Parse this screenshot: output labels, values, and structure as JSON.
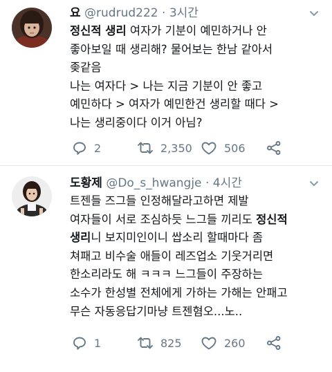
{
  "tweets": [
    {
      "name": "요",
      "handle": "@rudrud222",
      "separator": "·",
      "time": "3시간",
      "lines": [
        [
          {
            "text": "정신적 생리",
            "bold": true
          },
          {
            "text": " 여자가 기분이 예민하거나 안"
          }
        ],
        [
          {
            "text": "좋아보일 때 생리해? 물어보는 한남 같아서"
          }
        ],
        [
          {
            "text": "좆같음"
          }
        ],
        [
          {
            "text": "나는 여자다 > 나는 지금 기분이 안 좋고"
          }
        ],
        [
          {
            "text": "예민하다 > 여자가 예민한건 생리할 때다 >"
          }
        ],
        [
          {
            "text": "나는 생리중이다 이거 아님?"
          }
        ]
      ],
      "reply_count": "2",
      "retweet_count": "2,350",
      "like_count": "506",
      "icons": [
        "reply-icon",
        "retweet-icon",
        "like-icon",
        "share-icon",
        "caret-down-icon"
      ]
    },
    {
      "name": "도황제",
      "handle": "@Do_s_hwangje",
      "separator": "·",
      "time": "4시간",
      "lines": [
        [
          {
            "text": "트젠들 즈그들 인정해달라고하면 제발"
          }
        ],
        [
          {
            "text": "여자들이 서로 조심하듯 느그들 끼리도 "
          },
          {
            "text": "정신적",
            "bold": true
          }
        ],
        [
          {
            "text": "생리",
            "bold": true
          },
          {
            "text": "니 보지미인이니 쌉소리 할때마다 좀"
          }
        ],
        [
          {
            "text": "쳐패고 비수술 애들이 레즈업소 기웃거리면"
          }
        ],
        [
          {
            "text": "한소리라도 해 ㅋㅋㅋ 느그들이 주장하는"
          }
        ],
        [
          {
            "text": "소수가 한성별 전체에게 가하는 가해는 안패고"
          }
        ],
        [
          {
            "text": "무슨 자동응답기마냥 트젠혐오...노.."
          }
        ]
      ],
      "reply_count": "1",
      "retweet_count": "825",
      "like_count": "260",
      "icons": [
        "reply-icon",
        "retweet-icon",
        "like-icon",
        "share-icon",
        "caret-down-icon"
      ]
    }
  ],
  "colors": {
    "text": "#14171a",
    "secondary": "#657786",
    "divider": "#e1e8ed"
  }
}
